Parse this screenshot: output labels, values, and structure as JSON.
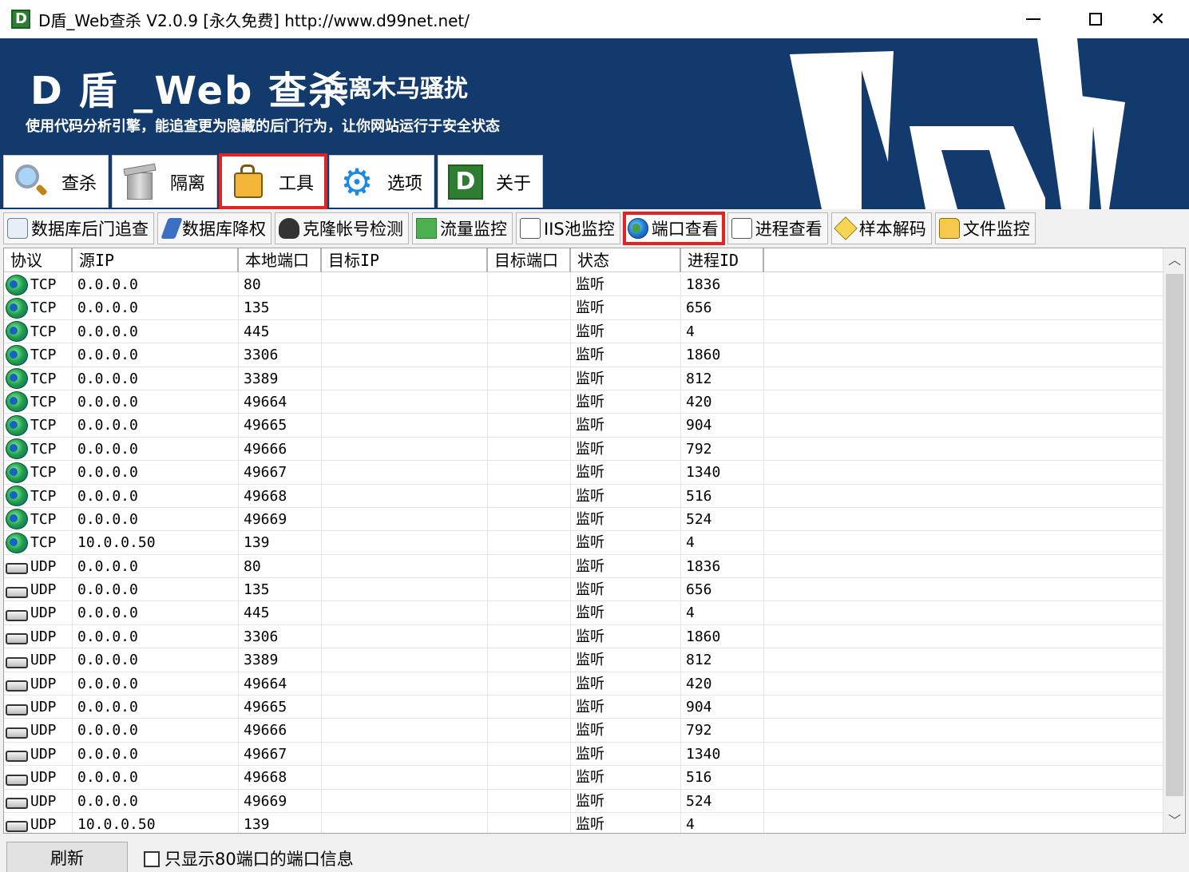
{
  "window": {
    "title": "D盾_Web查杀 V2.0.9 [永久免费] http://www.d99net.net/",
    "app_icon_letter": "D"
  },
  "banner": {
    "brand": "D 盾 _Web 查杀",
    "brand_sub": "远离木马骚扰",
    "tagline": "使用代码分析引擎，能追查更为隐藏的后门行为，让你网站运行于安全状态",
    "bg_color": "#123a6c"
  },
  "main_tabs": [
    {
      "label": "查杀",
      "icon": "magnifier-icon"
    },
    {
      "label": "隔离",
      "icon": "trash-icon"
    },
    {
      "label": "工具",
      "icon": "toolbag-icon",
      "highlighted": true
    },
    {
      "label": "选项",
      "icon": "gear-icon"
    },
    {
      "label": "关于",
      "icon": "d-logo-icon"
    }
  ],
  "sub_tabs": [
    {
      "label": "数据库后门追查",
      "icon": "database-icon"
    },
    {
      "label": "数据库降权",
      "icon": "pen-icon"
    },
    {
      "label": "克隆帐号检测",
      "icon": "user-icon"
    },
    {
      "label": "流量监控",
      "icon": "chart-icon"
    },
    {
      "label": "IIS池监控",
      "icon": "document-icon"
    },
    {
      "label": "端口查看",
      "icon": "globe-icon",
      "highlighted": true
    },
    {
      "label": "进程查看",
      "icon": "process-icon"
    },
    {
      "label": "样本解码",
      "icon": "diamond-icon"
    },
    {
      "label": "文件监控",
      "icon": "folder-icon"
    }
  ],
  "table": {
    "columns": [
      "协议",
      "源IP",
      "本地端口",
      "目标IP",
      "目标端口",
      "状态",
      "进程ID"
    ],
    "rows": [
      [
        "TCP",
        "0.0.0.0",
        "80",
        "",
        "",
        "监听",
        "1836"
      ],
      [
        "TCP",
        "0.0.0.0",
        "135",
        "",
        "",
        "监听",
        "656"
      ],
      [
        "TCP",
        "0.0.0.0",
        "445",
        "",
        "",
        "监听",
        "4"
      ],
      [
        "TCP",
        "0.0.0.0",
        "3306",
        "",
        "",
        "监听",
        "1860"
      ],
      [
        "TCP",
        "0.0.0.0",
        "3389",
        "",
        "",
        "监听",
        "812"
      ],
      [
        "TCP",
        "0.0.0.0",
        "49664",
        "",
        "",
        "监听",
        "420"
      ],
      [
        "TCP",
        "0.0.0.0",
        "49665",
        "",
        "",
        "监听",
        "904"
      ],
      [
        "TCP",
        "0.0.0.0",
        "49666",
        "",
        "",
        "监听",
        "792"
      ],
      [
        "TCP",
        "0.0.0.0",
        "49667",
        "",
        "",
        "监听",
        "1340"
      ],
      [
        "TCP",
        "0.0.0.0",
        "49668",
        "",
        "",
        "监听",
        "516"
      ],
      [
        "TCP",
        "0.0.0.0",
        "49669",
        "",
        "",
        "监听",
        "524"
      ],
      [
        "TCP",
        "10.0.0.50",
        "139",
        "",
        "",
        "监听",
        "4"
      ],
      [
        "UDP",
        "0.0.0.0",
        "80",
        "",
        "",
        "监听",
        "1836"
      ],
      [
        "UDP",
        "0.0.0.0",
        "135",
        "",
        "",
        "监听",
        "656"
      ],
      [
        "UDP",
        "0.0.0.0",
        "445",
        "",
        "",
        "监听",
        "4"
      ],
      [
        "UDP",
        "0.0.0.0",
        "3306",
        "",
        "",
        "监听",
        "1860"
      ],
      [
        "UDP",
        "0.0.0.0",
        "3389",
        "",
        "",
        "监听",
        "812"
      ],
      [
        "UDP",
        "0.0.0.0",
        "49664",
        "",
        "",
        "监听",
        "420"
      ],
      [
        "UDP",
        "0.0.0.0",
        "49665",
        "",
        "",
        "监听",
        "904"
      ],
      [
        "UDP",
        "0.0.0.0",
        "49666",
        "",
        "",
        "监听",
        "792"
      ],
      [
        "UDP",
        "0.0.0.0",
        "49667",
        "",
        "",
        "监听",
        "1340"
      ],
      [
        "UDP",
        "0.0.0.0",
        "49668",
        "",
        "",
        "监听",
        "516"
      ],
      [
        "UDP",
        "0.0.0.0",
        "49669",
        "",
        "",
        "监听",
        "524"
      ],
      [
        "UDP",
        "10.0.0.50",
        "139",
        "",
        "",
        "监听",
        "4"
      ]
    ]
  },
  "footer": {
    "refresh_label": "刷新",
    "checkbox_label": "只显示80端口的端口信息",
    "checkbox_checked": false
  },
  "colors": {
    "highlight": "#e02424",
    "banner": "#123a6c"
  }
}
